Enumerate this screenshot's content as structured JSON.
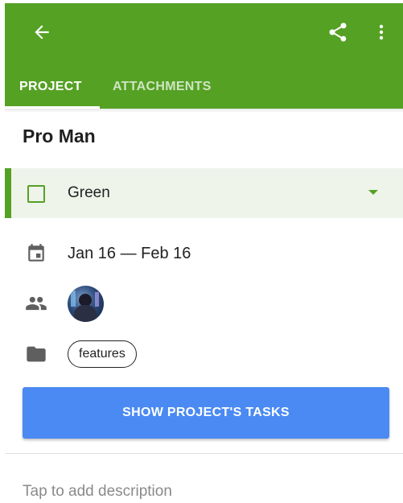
{
  "appbar": {
    "background": "#55a124",
    "back_icon": "arrow-left-icon",
    "share_icon": "share-icon",
    "more_icon": "more-vertical-icon"
  },
  "tabs": [
    {
      "label": "PROJECT",
      "active": true
    },
    {
      "label": "ATTACHMENTS",
      "active": false
    }
  ],
  "project": {
    "title": "Pro Man",
    "color": {
      "label": "Green",
      "value": "#55a124"
    },
    "dates": "Jan 16 — Feb 16",
    "date_icon": "calendar-icon",
    "members_icon": "people-icon",
    "folder_icon": "folder-icon",
    "tag": "features"
  },
  "actions": {
    "show_tasks_label": "SHOW PROJECT'S TASKS",
    "button_color": "#4a8af2"
  },
  "description": {
    "placeholder": "Tap to add description"
  }
}
